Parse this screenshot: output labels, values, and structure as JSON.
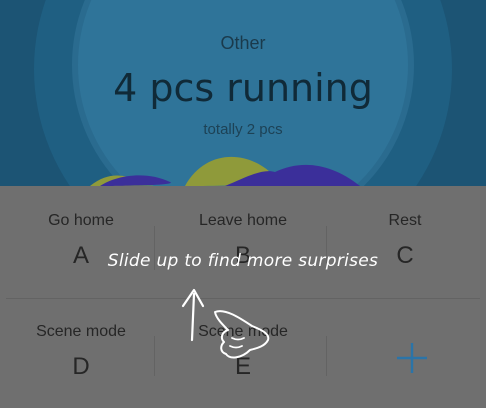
{
  "status": {
    "label": "Other",
    "main": "4 pcs running",
    "sub": "totally 2 pcs"
  },
  "scenes": [
    {
      "name": "Go home",
      "letter": "A"
    },
    {
      "name": "Leave home",
      "letter": "B"
    },
    {
      "name": "Rest",
      "letter": "C"
    },
    {
      "name": "Scene mode",
      "letter": "D"
    },
    {
      "name": "Scene mode",
      "letter": "E"
    }
  ],
  "add_icon": "plus-icon",
  "overlay": {
    "hint": "Slide up to find more surprises",
    "gesture_icon": "swipe-up-hand-icon"
  },
  "colors": {
    "accent": "#2b74a8",
    "panel": "#6f6f6f",
    "wave_purple": "#3b2f9a",
    "wave_yellow": "#8f9a3a"
  }
}
